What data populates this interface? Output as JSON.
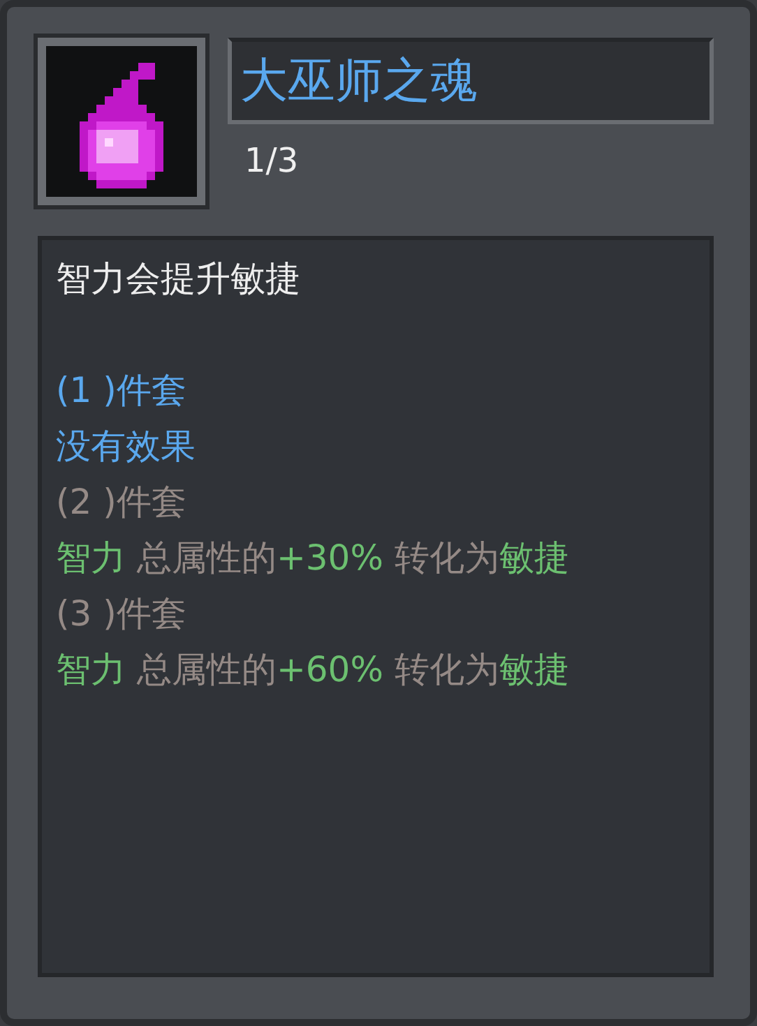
{
  "item": {
    "name": "大巫师之魂",
    "count": "1/3"
  },
  "description": "智力会提升敏捷",
  "set_tiers": [
    {
      "label": "(1 )件套",
      "active": true,
      "effect": [
        {
          "text": "没有效果"
        }
      ]
    },
    {
      "label": "(2 )件套",
      "active": false,
      "effect": [
        {
          "text": "智力",
          "highlight": true
        },
        {
          "text": " 总属性的",
          "highlight": false
        },
        {
          "text": "+30%",
          "highlight": true
        },
        {
          "text": " 转化为",
          "highlight": false
        },
        {
          "text": "敏捷",
          "highlight": true
        }
      ]
    },
    {
      "label": "(3 )件套",
      "active": false,
      "effect": [
        {
          "text": "智力",
          "highlight": true
        },
        {
          "text": " 总属性的",
          "highlight": false
        },
        {
          "text": "+60%",
          "highlight": true
        },
        {
          "text": " 转化为",
          "highlight": false
        },
        {
          "text": "敏捷",
          "highlight": true
        }
      ]
    }
  ]
}
